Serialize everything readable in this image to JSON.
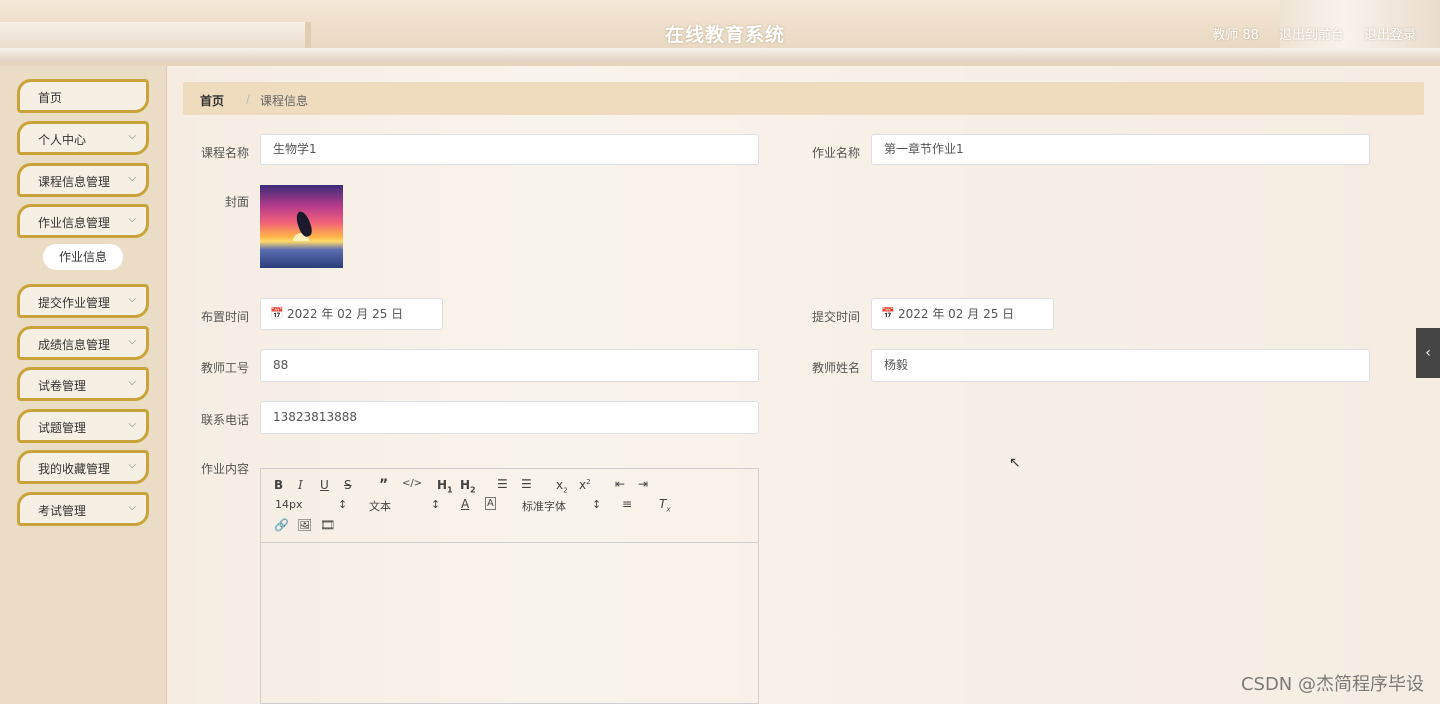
{
  "header": {
    "title": "在线教育系统",
    "user": "教师 88",
    "front_link": "退出到前台",
    "logout_link": "退出登录"
  },
  "sidebar": {
    "items": [
      {
        "label": "首页",
        "has_arrow": false
      },
      {
        "label": "个人中心",
        "has_arrow": true
      },
      {
        "label": "课程信息管理",
        "has_arrow": true
      },
      {
        "label": "作业信息管理",
        "has_arrow": true
      },
      {
        "label": "提交作业管理",
        "has_arrow": true
      },
      {
        "label": "成绩信息管理",
        "has_arrow": true
      },
      {
        "label": "试卷管理",
        "has_arrow": true
      },
      {
        "label": "试题管理",
        "has_arrow": true
      },
      {
        "label": "我的收藏管理",
        "has_arrow": true
      },
      {
        "label": "考试管理",
        "has_arrow": true
      }
    ],
    "active_sub": "作业信息"
  },
  "breadcrumb": {
    "home": "首页",
    "sep": "/",
    "current": "课程信息"
  },
  "form": {
    "course_name": {
      "label": "课程名称",
      "value": "生物学1"
    },
    "homework_name": {
      "label": "作业名称",
      "value": "第一章节作业1"
    },
    "cover": {
      "label": "封面"
    },
    "assign_time": {
      "label": "布置时间",
      "value": "2022 年 02 月 25 日"
    },
    "submit_time": {
      "label": "提交时间",
      "value": "2022 年 02 月 25 日"
    },
    "teacher_id": {
      "label": "教师工号",
      "value": "88"
    },
    "teacher_name": {
      "label": "教师姓名",
      "value": "杨毅"
    },
    "phone": {
      "label": "联系电话",
      "value": "13823813888"
    },
    "content": {
      "label": "作业内容"
    }
  },
  "editor": {
    "font_size": "14px",
    "text_type": "文本",
    "font_family": "标准字体"
  },
  "watermark": "CSDN @杰简程序毕设",
  "colors": {
    "menu_border": "#c9a43a",
    "breadcrumb_bg": "#efdcbf",
    "sidebar_bg": "#eadcc5"
  }
}
